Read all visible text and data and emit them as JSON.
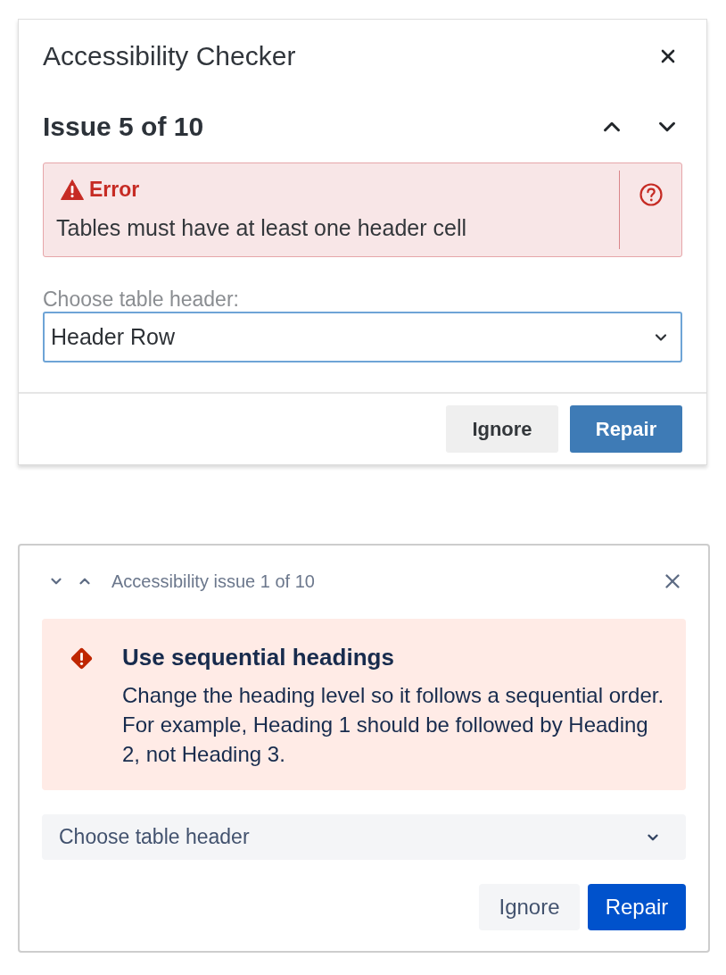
{
  "panels": [
    {
      "kind": "classic",
      "title": "Accessibility Checker",
      "issue_counter": "Issue 5 of 10",
      "alert": {
        "heading": "Error",
        "message": "Tables must have at least one header cell"
      },
      "field": {
        "label": "Choose table header:",
        "value": "Header Row",
        "focused": true
      },
      "buttons": [
        {
          "label": "Ignore",
          "kind": "secondary"
        },
        {
          "label": "Repair",
          "kind": "primary"
        }
      ]
    },
    {
      "kind": "modern",
      "issue_counter": "Accessibility issue 1 of 10",
      "alert": {
        "heading": "Use sequential headings",
        "message": "Change the heading level so it follows a sequential order. For example, Heading 1 should be followed by Heading 2, not Heading 3."
      },
      "field": {
        "placeholder": "Choose table header"
      },
      "buttons": [
        {
          "label": "Ignore",
          "kind": "secondary"
        },
        {
          "label": "Repair",
          "kind": "primary"
        }
      ]
    }
  ]
}
